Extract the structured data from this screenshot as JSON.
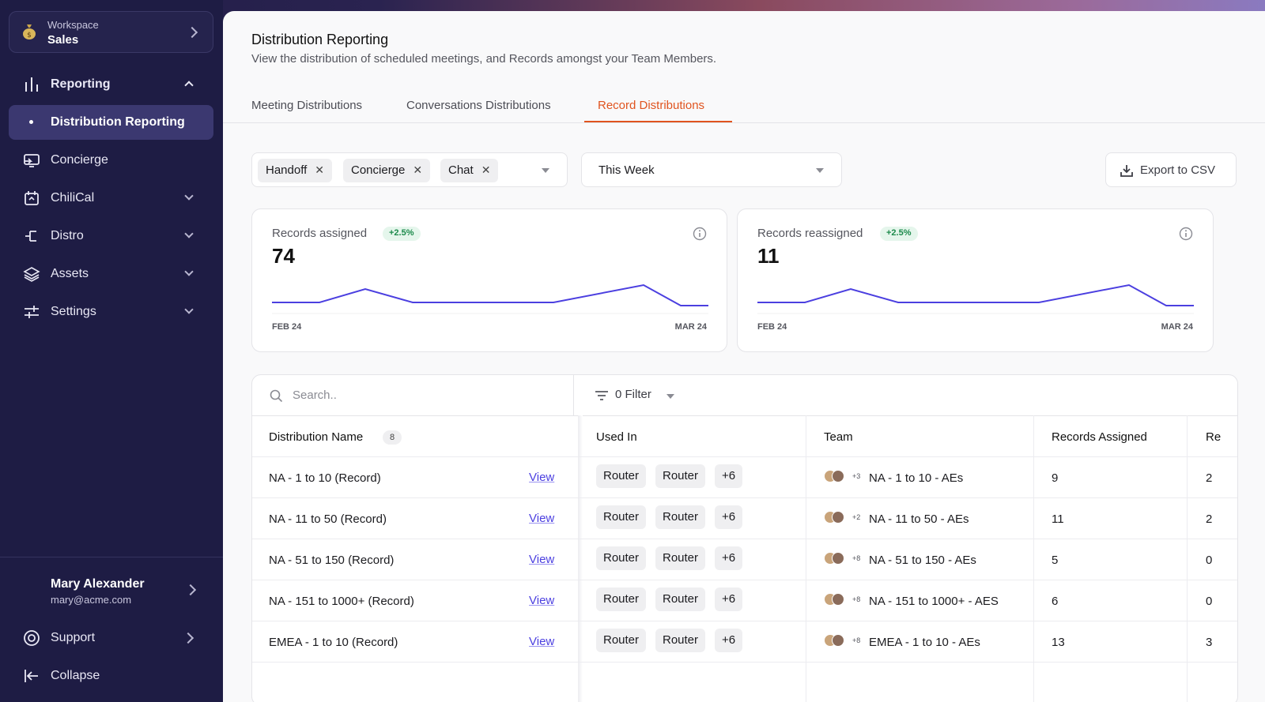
{
  "sidebar": {
    "workspace_label": "Workspace",
    "workspace_value": "Sales",
    "nav": [
      {
        "label": "Reporting",
        "icon": "bar-chart-icon"
      },
      {
        "label": "Distribution Reporting"
      },
      {
        "label": "Concierge",
        "icon": "concierge-icon"
      },
      {
        "label": "ChiliCal",
        "icon": "calendar-icon"
      },
      {
        "label": "Distro",
        "icon": "distro-icon"
      },
      {
        "label": "Assets",
        "icon": "layers-icon"
      },
      {
        "label": "Settings",
        "icon": "sliders-icon"
      }
    ],
    "user": {
      "name": "Mary Alexander",
      "email": "mary@acme.com"
    },
    "support_label": "Support",
    "collapse_label": "Collapse"
  },
  "header": {
    "title": "Distribution Reporting",
    "subtitle": "View the distribution of scheduled meetings, and Records amongst your Team Members."
  },
  "tabs": [
    {
      "label": "Meeting Distributions"
    },
    {
      "label": "Conversations Distributions"
    },
    {
      "label": "Record Distributions",
      "active": true
    }
  ],
  "filters": {
    "chips": [
      "Handoff",
      "Concierge",
      "Chat"
    ],
    "period": "This Week",
    "export_label": "Export to CSV"
  },
  "cards": [
    {
      "label": "Records assigned",
      "badge": "+2.5%",
      "value": "74",
      "x_start": "FEB 24",
      "x_end": "MAR 24"
    },
    {
      "label": "Records reassigned",
      "badge": "+2.5%",
      "value": "11",
      "x_start": "FEB 24",
      "x_end": "MAR 24"
    }
  ],
  "table": {
    "search_placeholder": "Search..",
    "filter_label": "0 Filter",
    "headers": {
      "name": "Distribution Name",
      "count": "8",
      "used_in": "Used In",
      "team": "Team",
      "records_assigned": "Records Assigned",
      "next": "Re"
    },
    "view_label": "View",
    "rows": [
      {
        "name": "NA - 1 to 10 (Record)",
        "used": [
          "Router",
          "Router",
          "+6"
        ],
        "more": "+3",
        "team": "NA - 1 to 10 - AEs",
        "assigned": "9",
        "next": "2"
      },
      {
        "name": "NA - 11 to 50 (Record)",
        "used": [
          "Router",
          "Router",
          "+6"
        ],
        "more": "+2",
        "team": "NA - 11 to 50 - AEs",
        "assigned": "11",
        "next": "2"
      },
      {
        "name": "NA - 51 to 150 (Record)",
        "used": [
          "Router",
          "Router",
          "+6"
        ],
        "more": "+8",
        "team": "NA - 51 to 150 - AEs",
        "assigned": "5",
        "next": "0"
      },
      {
        "name": "NA - 151 to 1000+ (Record)",
        "used": [
          "Router",
          "Router",
          "+6"
        ],
        "more": "+8",
        "team": "NA - 151 to 1000+ - AES",
        "assigned": "6",
        "next": "0"
      },
      {
        "name": "EMEA - 1 to 10 (Record)",
        "used": [
          "Router",
          "Router",
          "+6"
        ],
        "more": "+8",
        "team": "EMEA - 1 to 10 - AEs",
        "assigned": "13",
        "next": "3"
      }
    ]
  },
  "colors": {
    "accent": "#e0541f",
    "sidebar": "#1e1c44",
    "link": "#4b3fe0",
    "sparkline": "#4b3fe0",
    "badge_green": "#1c8a4b"
  }
}
